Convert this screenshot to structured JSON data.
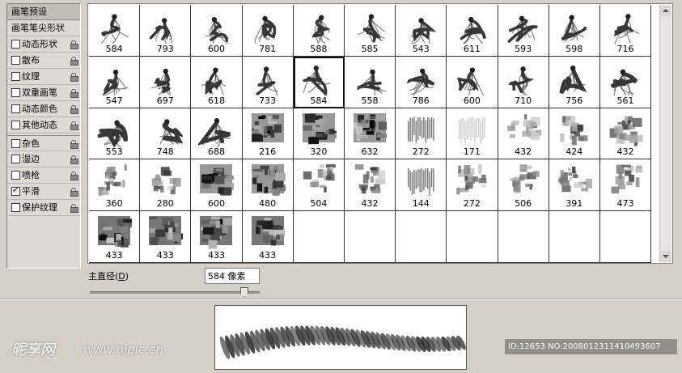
{
  "panel": {
    "title": "画笔预设",
    "items": [
      {
        "label": "画笔笔尖形状",
        "checkbox": false,
        "lock": false,
        "gap": false
      },
      {
        "label": "动态形状",
        "checkbox": true,
        "checked": false,
        "lock": true,
        "gap": false
      },
      {
        "label": "散布",
        "checkbox": true,
        "checked": false,
        "lock": true,
        "gap": false
      },
      {
        "label": "纹理",
        "checkbox": true,
        "checked": false,
        "lock": true,
        "gap": false
      },
      {
        "label": "双重画笔",
        "checkbox": true,
        "checked": false,
        "lock": true,
        "gap": false
      },
      {
        "label": "动态颜色",
        "checkbox": true,
        "checked": false,
        "lock": true,
        "gap": false
      },
      {
        "label": "其他动态",
        "checkbox": true,
        "checked": false,
        "lock": true,
        "gap": false
      },
      {
        "label": "杂色",
        "checkbox": true,
        "checked": false,
        "lock": true,
        "gap": true
      },
      {
        "label": "湿边",
        "checkbox": true,
        "checked": false,
        "lock": true,
        "gap": false
      },
      {
        "label": "喷枪",
        "checkbox": true,
        "checked": false,
        "lock": true,
        "gap": false
      },
      {
        "label": "平滑",
        "checkbox": true,
        "checked": true,
        "lock": true,
        "gap": false
      },
      {
        "label": "保护纹理",
        "checkbox": true,
        "checked": false,
        "lock": true,
        "gap": false
      }
    ]
  },
  "brushes": [
    {
      "size": "584",
      "kind": "figure"
    },
    {
      "size": "793",
      "kind": "figure"
    },
    {
      "size": "600",
      "kind": "figure"
    },
    {
      "size": "781",
      "kind": "figure"
    },
    {
      "size": "588",
      "kind": "figure"
    },
    {
      "size": "585",
      "kind": "figure"
    },
    {
      "size": "543",
      "kind": "figure"
    },
    {
      "size": "611",
      "kind": "figure"
    },
    {
      "size": "593",
      "kind": "figure"
    },
    {
      "size": "598",
      "kind": "figure"
    },
    {
      "size": "716",
      "kind": "figure"
    },
    {
      "size": "547",
      "kind": "figure"
    },
    {
      "size": "697",
      "kind": "figure"
    },
    {
      "size": "618",
      "kind": "figure"
    },
    {
      "size": "733",
      "kind": "figure"
    },
    {
      "size": "584",
      "kind": "figure",
      "selected": true
    },
    {
      "size": "558",
      "kind": "figure"
    },
    {
      "size": "786",
      "kind": "figure"
    },
    {
      "size": "600",
      "kind": "figure"
    },
    {
      "size": "710",
      "kind": "figure"
    },
    {
      "size": "756",
      "kind": "beast"
    },
    {
      "size": "561",
      "kind": "beast"
    },
    {
      "size": "553",
      "kind": "beast"
    },
    {
      "size": "748",
      "kind": "beast"
    },
    {
      "size": "688",
      "kind": "beast"
    },
    {
      "size": "216",
      "kind": "texture"
    },
    {
      "size": "320",
      "kind": "texture"
    },
    {
      "size": "632",
      "kind": "texture"
    },
    {
      "size": "272",
      "kind": "stripes"
    },
    {
      "size": "171",
      "kind": "stripes-light"
    },
    {
      "size": "432",
      "kind": "splatter"
    },
    {
      "size": "424",
      "kind": "splatter"
    },
    {
      "size": "432",
      "kind": "splatter"
    },
    {
      "size": "360",
      "kind": "splatter"
    },
    {
      "size": "280",
      "kind": "splatter"
    },
    {
      "size": "600",
      "kind": "texture"
    },
    {
      "size": "480",
      "kind": "texture"
    },
    {
      "size": "504",
      "kind": "splatter"
    },
    {
      "size": "432",
      "kind": "splatter"
    },
    {
      "size": "144",
      "kind": "stripes"
    },
    {
      "size": "272",
      "kind": "splatter"
    },
    {
      "size": "506",
      "kind": "splatter"
    },
    {
      "size": "391",
      "kind": "splatter"
    },
    {
      "size": "473",
      "kind": "splatter"
    },
    {
      "size": "433",
      "kind": "mosaic"
    },
    {
      "size": "433",
      "kind": "mosaic"
    },
    {
      "size": "433",
      "kind": "mosaic"
    },
    {
      "size": "433",
      "kind": "mosaic"
    }
  ],
  "diameter": {
    "label_prefix": "主直径(",
    "label_key": "D",
    "label_suffix": ")",
    "value": "584 像素",
    "slider_fraction": 0.91
  },
  "watermark": {
    "logo": "昵享网",
    "url": "www.nipic.cn",
    "id_text": "ID:12653 NO:20080123114104936​07"
  }
}
